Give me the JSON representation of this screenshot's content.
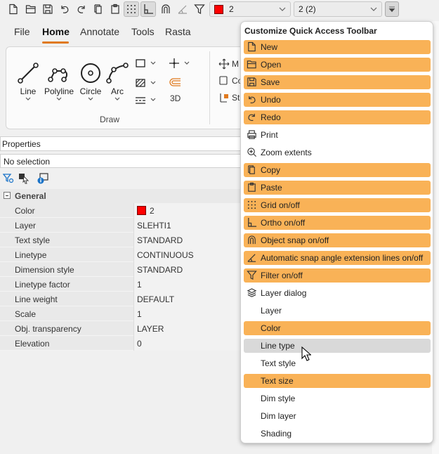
{
  "qat": {
    "color_value": "2",
    "layer_value": "2 (2)",
    "icons": [
      "new-icon",
      "open-icon",
      "save-icon",
      "undo-icon",
      "redo-icon",
      "copy-icon",
      "paste-icon",
      "grid-icon",
      "ortho-icon",
      "osnap-icon",
      "snap-angle-icon",
      "filter-icon"
    ],
    "accent": "#e07a1f"
  },
  "menubar": {
    "tabs": [
      {
        "label": "File"
      },
      {
        "label": "Home"
      },
      {
        "label": "Annotate"
      },
      {
        "label": "Tools"
      },
      {
        "label": "Rasta"
      }
    ],
    "active": "Home"
  },
  "ribbon": {
    "draw": {
      "line": "Line",
      "polyline": "Polyline",
      "circle": "Circle",
      "arc": "Arc",
      "three_d": "3D",
      "group_label": "Draw"
    },
    "modify": {
      "m": "M",
      "co": "Co",
      "str": "Str"
    }
  },
  "properties": {
    "title": "Properties",
    "selection": "No selection",
    "group": "General",
    "rows": [
      {
        "name": "Color",
        "value": "2",
        "swatch": "#ff0000"
      },
      {
        "name": "Layer",
        "value": "SLEHTI1"
      },
      {
        "name": "Text style",
        "value": "STANDARD"
      },
      {
        "name": "Linetype",
        "value": "CONTINUOUS"
      },
      {
        "name": "Dimension style",
        "value": "STANDARD"
      },
      {
        "name": "Linetype factor",
        "value": "1"
      },
      {
        "name": "Line weight",
        "value": "DEFAULT"
      },
      {
        "name": "Scale",
        "value": "1"
      },
      {
        "name": "Obj. transparency",
        "value": "LAYER"
      },
      {
        "name": "Elevation",
        "value": "0"
      }
    ]
  },
  "popup": {
    "title": "Customize Quick Access Toolbar",
    "checked_color": "#f9b257",
    "hover_color": "#d9d9d9",
    "items": [
      {
        "label": "New",
        "icon": "new-icon",
        "checked": true
      },
      {
        "label": "Open",
        "icon": "open-icon",
        "checked": true
      },
      {
        "label": "Save",
        "icon": "save-icon",
        "checked": true
      },
      {
        "label": "Undo",
        "icon": "undo-icon",
        "checked": true
      },
      {
        "label": "Redo",
        "icon": "redo-icon",
        "checked": true
      },
      {
        "label": "Print",
        "icon": "print-icon",
        "checked": false
      },
      {
        "label": "Zoom extents",
        "icon": "zoom-extents-icon",
        "checked": false
      },
      {
        "label": "Copy",
        "icon": "copy-icon",
        "checked": true
      },
      {
        "label": "Paste",
        "icon": "paste-icon",
        "checked": true
      },
      {
        "label": "Grid on/off",
        "icon": "grid-icon",
        "checked": true
      },
      {
        "label": "Ortho on/off",
        "icon": "ortho-icon",
        "checked": true
      },
      {
        "label": "Object snap on/off",
        "icon": "osnap-icon",
        "checked": true
      },
      {
        "label": "Automatic snap angle extension lines on/off",
        "icon": "snap-angle-icon",
        "checked": true
      },
      {
        "label": "Filter on/off",
        "icon": "filter-icon",
        "checked": true
      },
      {
        "label": "Layer dialog",
        "icon": "layers-icon",
        "checked": false
      },
      {
        "label": "Layer",
        "icon": "",
        "checked": false
      },
      {
        "label": "Color",
        "icon": "",
        "checked": true
      },
      {
        "label": "Line type",
        "icon": "",
        "checked": false,
        "hover": true
      },
      {
        "label": "Text style",
        "icon": "",
        "checked": false
      },
      {
        "label": "Text size",
        "icon": "",
        "checked": true
      },
      {
        "label": "Dim style",
        "icon": "",
        "checked": false
      },
      {
        "label": "Dim layer",
        "icon": "",
        "checked": false
      },
      {
        "label": "Shading",
        "icon": "",
        "checked": false
      }
    ]
  }
}
